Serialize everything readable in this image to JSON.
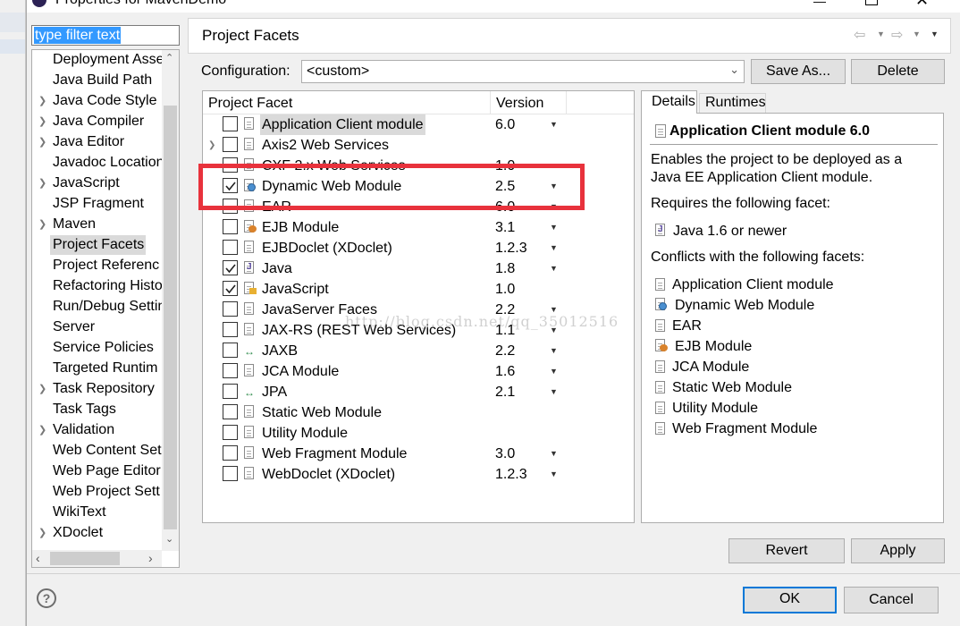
{
  "window": {
    "title": "Properties for MavenDemo"
  },
  "filter": {
    "value": "type filter text"
  },
  "tree": {
    "items": [
      {
        "label": "Deployment Asse",
        "expandable": false
      },
      {
        "label": "Java Build Path",
        "expandable": false
      },
      {
        "label": "Java Code Style",
        "expandable": true
      },
      {
        "label": "Java Compiler",
        "expandable": true
      },
      {
        "label": "Java Editor",
        "expandable": true
      },
      {
        "label": "Javadoc Location",
        "expandable": false
      },
      {
        "label": "JavaScript",
        "expandable": true
      },
      {
        "label": "JSP Fragment",
        "expandable": false
      },
      {
        "label": "Maven",
        "expandable": true
      },
      {
        "label": "Project Facets",
        "expandable": false,
        "selected": true
      },
      {
        "label": "Project Referenc",
        "expandable": false
      },
      {
        "label": "Refactoring Histo",
        "expandable": false
      },
      {
        "label": "Run/Debug Settin",
        "expandable": false
      },
      {
        "label": "Server",
        "expandable": false
      },
      {
        "label": "Service Policies",
        "expandable": false
      },
      {
        "label": "Targeted Runtim",
        "expandable": false
      },
      {
        "label": "Task Repository",
        "expandable": true
      },
      {
        "label": "Task Tags",
        "expandable": false
      },
      {
        "label": "Validation",
        "expandable": true
      },
      {
        "label": "Web Content Set",
        "expandable": false
      },
      {
        "label": "Web Page Editor",
        "expandable": false
      },
      {
        "label": "Web Project Sett",
        "expandable": false
      },
      {
        "label": "WikiText",
        "expandable": false
      },
      {
        "label": "XDoclet",
        "expandable": true
      }
    ]
  },
  "page": {
    "title": "Project Facets"
  },
  "configuration": {
    "label": "Configuration:",
    "value": "<custom>",
    "save_as": "Save As...",
    "delete": "Delete"
  },
  "facets": {
    "col_facet": "Project Facet",
    "col_version": "Version",
    "rows": [
      {
        "name": "Application Client module",
        "version": "6.0",
        "checked": false,
        "dropdown": true,
        "highlight": true,
        "icon": "document-icon"
      },
      {
        "name": "Axis2 Web Services",
        "version": "",
        "checked": false,
        "dropdown": false,
        "expandable": true,
        "icon": "document-icon"
      },
      {
        "name": "CXF 2.x Web Services",
        "version": "1.0",
        "checked": false,
        "dropdown": false,
        "icon": "document-icon"
      },
      {
        "name": "Dynamic Web Module",
        "version": "2.5",
        "checked": true,
        "dropdown": true,
        "icon": "globe-icon"
      },
      {
        "name": "EAR",
        "version": "6.0",
        "checked": false,
        "dropdown": true,
        "icon": "document-icon"
      },
      {
        "name": "EJB Module",
        "version": "3.1",
        "checked": false,
        "dropdown": true,
        "icon": "bean-icon"
      },
      {
        "name": "EJBDoclet (XDoclet)",
        "version": "1.2.3",
        "checked": false,
        "dropdown": true,
        "icon": "document-icon"
      },
      {
        "name": "Java",
        "version": "1.8",
        "checked": true,
        "dropdown": true,
        "icon": "java-icon"
      },
      {
        "name": "JavaScript",
        "version": "1.0",
        "checked": true,
        "dropdown": false,
        "icon": "javascript-icon"
      },
      {
        "name": "JavaServer Faces",
        "version": "2.2",
        "checked": false,
        "dropdown": true,
        "icon": "document-icon"
      },
      {
        "name": "JAX-RS (REST Web Services)",
        "version": "1.1",
        "checked": false,
        "dropdown": true,
        "icon": "document-icon"
      },
      {
        "name": "JAXB",
        "version": "2.2",
        "checked": false,
        "dropdown": true,
        "icon": "arrows-icon"
      },
      {
        "name": "JCA Module",
        "version": "1.6",
        "checked": false,
        "dropdown": true,
        "icon": "document-icon"
      },
      {
        "name": "JPA",
        "version": "2.1",
        "checked": false,
        "dropdown": true,
        "icon": "arrows-icon"
      },
      {
        "name": "Static Web Module",
        "version": "",
        "checked": false,
        "dropdown": false,
        "icon": "document-icon"
      },
      {
        "name": "Utility Module",
        "version": "",
        "checked": false,
        "dropdown": false,
        "icon": "document-icon"
      },
      {
        "name": "Web Fragment Module",
        "version": "3.0",
        "checked": false,
        "dropdown": true,
        "icon": "document-icon"
      },
      {
        "name": "WebDoclet (XDoclet)",
        "version": "1.2.3",
        "checked": false,
        "dropdown": true,
        "icon": "document-icon"
      }
    ]
  },
  "details": {
    "tab_details": "Details",
    "tab_runtimes": "Runtimes",
    "heading": "Application Client module 6.0",
    "description": "Enables the project to be deployed as a Java EE Application Client module.",
    "requires_label": "Requires the following facet:",
    "requires": [
      {
        "name": "Java 1.6 or newer",
        "icon": "java-icon"
      }
    ],
    "conflicts_label": "Conflicts with the following facets:",
    "conflicts": [
      {
        "name": "Application Client module",
        "icon": "document-icon"
      },
      {
        "name": "Dynamic Web Module",
        "icon": "globe-icon"
      },
      {
        "name": "EAR",
        "icon": "document-icon"
      },
      {
        "name": "EJB Module",
        "icon": "bean-icon"
      },
      {
        "name": "JCA Module",
        "icon": "document-icon"
      },
      {
        "name": "Static Web Module",
        "icon": "document-icon"
      },
      {
        "name": "Utility Module",
        "icon": "document-icon"
      },
      {
        "name": "Web Fragment Module",
        "icon": "document-icon"
      }
    ]
  },
  "buttons": {
    "revert": "Revert",
    "apply": "Apply",
    "ok": "OK",
    "cancel": "Cancel"
  },
  "watermark": "http://blog.csdn.net/qq_35012516",
  "colors": {
    "highlight_box": "#e8323c",
    "selection": "#cce8ff",
    "filter_selection": "#3399ff",
    "primary_border": "#0078d7"
  }
}
